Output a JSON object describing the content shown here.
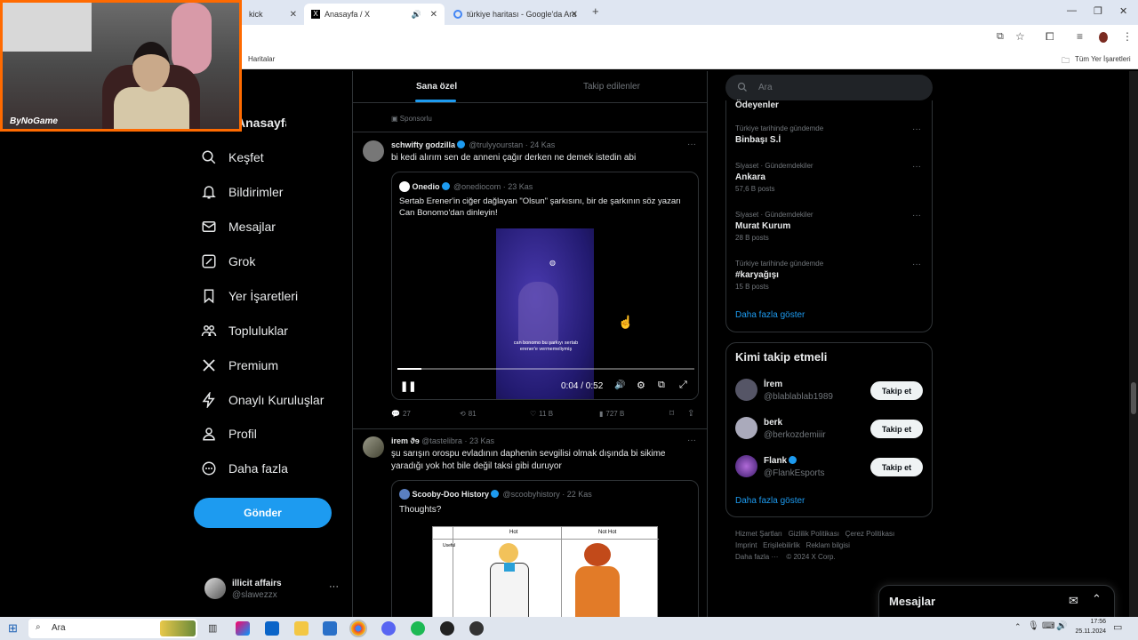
{
  "browser": {
    "tabs": [
      {
        "label": "kick"
      },
      {
        "label": "Anasayfa / X"
      },
      {
        "label": "türkiye haritası - Google'da Ara"
      }
    ],
    "bookmarks": {
      "left": "Haritalar",
      "right": "Tüm Yer İşaretleri"
    }
  },
  "webcam": {
    "overlay": "ByNoGame"
  },
  "nav": {
    "home": "Anasayfa",
    "items": [
      "Keşfet",
      "Bildirimler",
      "Mesajlar",
      "Grok",
      "Yer İşaretleri",
      "Topluluklar",
      "Premium",
      "Onaylı Kuruluşlar",
      "Profil",
      "Daha fazla"
    ],
    "post_button": "Gönder",
    "account": {
      "name": "illicit affairs",
      "handle": "@slawezzx"
    }
  },
  "feed": {
    "tabs": [
      "Sana özel",
      "Takip edilenler"
    ],
    "sponsored": "Sponsorlu",
    "tweets": [
      {
        "name": "schwifty godzilla",
        "handle": "@trulyyourstan",
        "time": "· 24 Kas",
        "text": "bi kedi alırım sen de anneni çağır derken ne demek istedin abi",
        "quote": {
          "name": "Onedio",
          "handle": "@onediocom",
          "time": "· 23 Kas",
          "text": "Sertab Erener'in ciğer dağlayan \"Olsun\" şarkısını, bir de şarkının söz yazarı Can Bonomo'dan dinleyin!",
          "video_caption": "can bonomo bu şarkıyı sertab erener'e vermemeliymiş",
          "video_time": "0:04 / 0:52",
          "progress": 0.08
        },
        "stats": {
          "replies": "27",
          "reposts": "81",
          "likes": "11 B",
          "views": "727 B"
        }
      },
      {
        "name": "irem ϑɘ",
        "handle": "@tastelibra",
        "time": "· 23 Kas",
        "text": "şu sarışın orospu evladının daphenin sevgilisi olmak dışında bi sikime yaradığı yok hot bile değil taksi gibi duruyor",
        "quote": {
          "name": "Scooby-Doo History",
          "handle": "@scoobyhistory",
          "time": "· 22 Kas",
          "text": "Thoughts?",
          "table": {
            "headers": [
              "Hot",
              "Not Hot"
            ],
            "row_label": "Useful"
          }
        }
      }
    ]
  },
  "sidebar": {
    "search_placeholder": "Ara",
    "trends_top": "Ödeyenler",
    "trends": [
      {
        "meta": "Türkiye tarihinde gündemde",
        "name": "Binbaşı S.İ",
        "posts": ""
      },
      {
        "meta": "Siyaset · Gündemdekiler",
        "name": "Ankara",
        "posts": "57,6 B posts"
      },
      {
        "meta": "Siyaset · Gündemdekiler",
        "name": "Murat Kurum",
        "posts": "28 B posts"
      },
      {
        "meta": "Türkiye tarihinde gündemde",
        "name": "#karyağışı",
        "posts": "15 B posts"
      }
    ],
    "show_more": "Daha fazla göster",
    "who_to_follow": {
      "title": "Kimi takip etmeli",
      "users": [
        {
          "name": "İrem",
          "handle": "@blablablab1989"
        },
        {
          "name": "berk",
          "handle": "@berkozdemiiir"
        },
        {
          "name": "Flank",
          "handle": "@FlankEsports"
        }
      ],
      "follow_label": "Takip et",
      "show_more": "Daha fazla göster"
    },
    "footer": {
      "line1": [
        "Hizmet Şartları",
        "Gizlilik Politikası",
        "Çerez Politikası"
      ],
      "line2": [
        "Imprint",
        "Erişilebilirlik",
        "Reklam bilgisi"
      ],
      "line3": [
        "Daha fazla ···",
        "© 2024 X Corp."
      ]
    },
    "messages_drawer": "Mesajlar"
  },
  "taskbar": {
    "search": "Ara",
    "time": "17:56",
    "date": "25.11.2024"
  },
  "colors": {
    "accent": "#1d9bf0",
    "bg": "#000000",
    "border": "#2f3336",
    "muted": "#71767b"
  }
}
